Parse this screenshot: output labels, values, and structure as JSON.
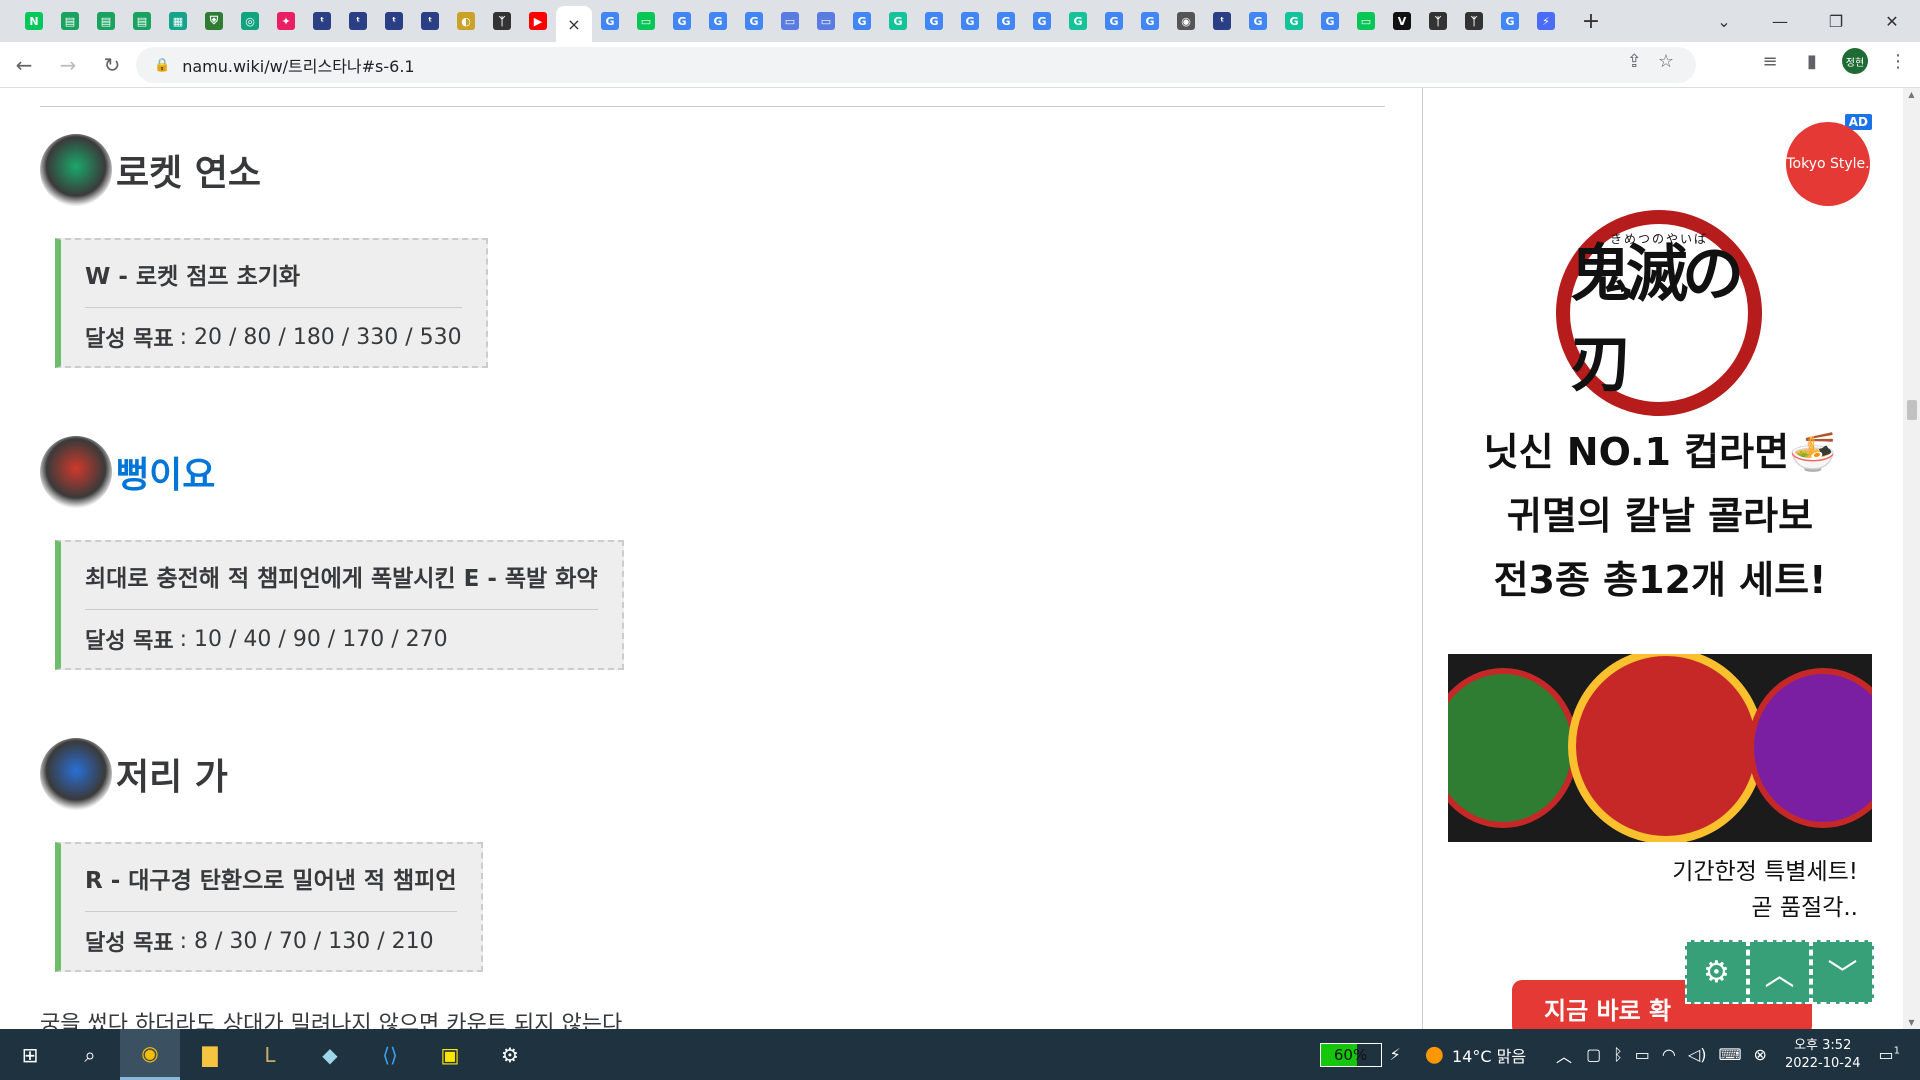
{
  "browser": {
    "tabs": [
      {
        "icon": "naver-icon",
        "color": "#03c75a",
        "glyph": "N"
      },
      {
        "icon": "sheet-icon",
        "color": "#1aa260",
        "glyph": "▤"
      },
      {
        "icon": "sheet-icon",
        "color": "#1aa260",
        "glyph": "▤"
      },
      {
        "icon": "sheet-icon",
        "color": "#1aa260",
        "glyph": "▤"
      },
      {
        "icon": "image-icon",
        "color": "#14a38b",
        "glyph": "▦"
      },
      {
        "icon": "shield-icon",
        "color": "#2e7d32",
        "glyph": "⛨"
      },
      {
        "icon": "chat-icon",
        "color": "#10a37f",
        "glyph": "◎"
      },
      {
        "icon": "app-icon",
        "color": "#e91e63",
        "glyph": "✦"
      },
      {
        "icon": "bookmark-icon",
        "color": "#2a3f84",
        "glyph": "ᵗ"
      },
      {
        "icon": "bookmark-icon",
        "color": "#2a3f84",
        "glyph": "ᵗ"
      },
      {
        "icon": "bookmark-icon",
        "color": "#2a3f84",
        "glyph": "ᵗ"
      },
      {
        "icon": "bookmark-icon",
        "color": "#2a3f84",
        "glyph": "ᵗ"
      },
      {
        "icon": "coin-icon",
        "color": "#c9a227",
        "glyph": "◐"
      },
      {
        "icon": "tree-icon",
        "color": "#333333",
        "glyph": "ᛉ"
      },
      {
        "icon": "youtube-icon",
        "color": "#ff0000",
        "glyph": "▶"
      },
      {
        "icon": "namu-icon",
        "color": "#00a495",
        "glyph": "×",
        "active": true
      },
      {
        "icon": "google-icon",
        "color": "#4285f4",
        "glyph": "G"
      },
      {
        "icon": "chat-icon",
        "color": "#06c755",
        "glyph": "▭"
      },
      {
        "icon": "google-icon",
        "color": "#4285f4",
        "glyph": "G"
      },
      {
        "icon": "google-icon",
        "color": "#4285f4",
        "glyph": "G"
      },
      {
        "icon": "google-icon",
        "color": "#4285f4",
        "glyph": "G"
      },
      {
        "icon": "papago-icon",
        "color": "#5a7be0",
        "glyph": "▭"
      },
      {
        "icon": "papago-icon",
        "color": "#5a7be0",
        "glyph": "▭"
      },
      {
        "icon": "google-icon",
        "color": "#4285f4",
        "glyph": "G"
      },
      {
        "icon": "grammarly-icon",
        "color": "#15c39a",
        "glyph": "G"
      },
      {
        "icon": "google-icon",
        "color": "#4285f4",
        "glyph": "G"
      },
      {
        "icon": "google-icon",
        "color": "#4285f4",
        "glyph": "G"
      },
      {
        "icon": "google-icon",
        "color": "#4285f4",
        "glyph": "G"
      },
      {
        "icon": "google-icon",
        "color": "#4285f4",
        "glyph": "G"
      },
      {
        "icon": "grammarly-icon",
        "color": "#15c39a",
        "glyph": "G"
      },
      {
        "icon": "google-icon",
        "color": "#4285f4",
        "glyph": "G"
      },
      {
        "icon": "google-icon",
        "color": "#4285f4",
        "glyph": "G"
      },
      {
        "icon": "globe-icon",
        "color": "#555555",
        "glyph": "◉"
      },
      {
        "icon": "bookmark-icon",
        "color": "#2a3f84",
        "glyph": "ᵗ"
      },
      {
        "icon": "google-icon",
        "color": "#4285f4",
        "glyph": "G"
      },
      {
        "icon": "grammarly-icon",
        "color": "#15c39a",
        "glyph": "G"
      },
      {
        "icon": "google-icon",
        "color": "#4285f4",
        "glyph": "G"
      },
      {
        "icon": "line-icon",
        "color": "#06c755",
        "glyph": "▭"
      },
      {
        "icon": "v-icon",
        "color": "#111111",
        "glyph": "V"
      },
      {
        "icon": "tree-icon",
        "color": "#333333",
        "glyph": "ᛉ"
      },
      {
        "icon": "tree-icon",
        "color": "#333333",
        "glyph": "ᛉ"
      },
      {
        "icon": "google-icon",
        "color": "#4285f4",
        "glyph": "G"
      },
      {
        "icon": "app-icon",
        "color": "#4a6cf7",
        "glyph": "⚡"
      }
    ],
    "new_tab": "+",
    "url": "namu.wiki/w/트리스타나#s-6.1",
    "profile_label": "정현"
  },
  "content": {
    "sections": [
      {
        "title": "로켓 연소",
        "is_link": false,
        "emblem_color": "#1aa86a",
        "achievement": "W - 로켓 점프 초기화",
        "goal_label": "달성 목표",
        "goal_values": ": 20 / 80 / 180 / 330 / 530"
      },
      {
        "title": "뻥이요",
        "is_link": true,
        "emblem_color": "#d0392b",
        "achievement": "최대로 충전해 적 챔피언에게 폭발시킨 E - 폭발 화약",
        "goal_label": "달성 목표",
        "goal_values": ": 10 / 40 / 90 / 170 / 270"
      },
      {
        "title": "저리 가",
        "is_link": false,
        "emblem_color": "#2a6fd6",
        "achievement": "R - 대구경 탄환으로 밀어낸 적 챔피언",
        "goal_label": "달성 목표",
        "goal_values": ": 8 / 30 / 70 / 130 / 210"
      }
    ],
    "footer_partial": "궁을 썼다 하더라도 상대가 밀려나지 않으면 카운트 되지 않는다"
  },
  "ad": {
    "badge": "AD",
    "brand": "Tokyo Style.",
    "logo_text": "鬼滅の刃",
    "logo_kana": "きめつのやいば",
    "headline": [
      "닛신 NO.1 컵라면🍜",
      "귀멸의 칼날 콜라보",
      "전3종 총12개 세트!"
    ],
    "sub": [
      "기간한정 특별세트!",
      "곧 품절각.."
    ],
    "cta": "지금 바로 확"
  },
  "float_buttons": [
    "⚙",
    "︿",
    "﹀"
  ],
  "taskbar": {
    "battery": "60%",
    "battery_level": 0.6,
    "weather": "14°C  맑음",
    "time": "오후 3:52",
    "date": "2022-10-24",
    "notifications": "1"
  }
}
